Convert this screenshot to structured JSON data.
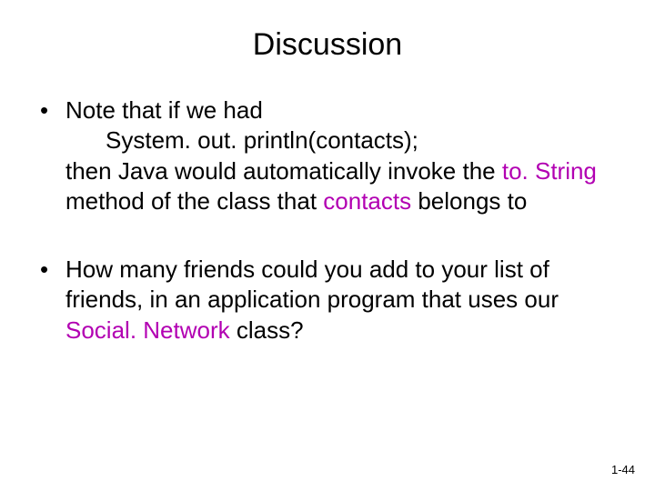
{
  "title": "Discussion",
  "bullet1": {
    "lead": "Note that if we had",
    "code": "System. out. println(contacts);",
    "t1": "then Java would automatically invoke the ",
    "toStr": "to. String",
    "t2": " method of the class that ",
    "contacts": "contacts",
    "t3": " belongs to"
  },
  "bullet2": {
    "t1": "How many friends could you add to your list of friends, in an application program that uses our ",
    "sn": "Social. Network",
    "t2": " class?"
  },
  "pageNumber": "1-44"
}
